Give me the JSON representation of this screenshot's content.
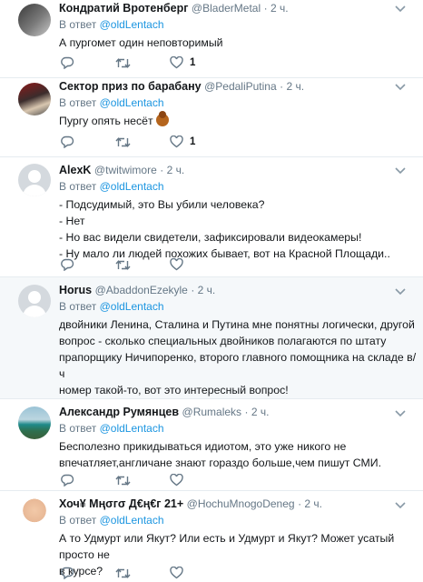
{
  "reply_prefix": "В ответ",
  "tweets": [
    {
      "name": "Кондратий Вротенберг",
      "handle": "@BladerMetal",
      "time": "· 2 ч.",
      "reply_to": "@oldLentach",
      "text": [
        "А пургомет один неповторимый"
      ],
      "likes": "1"
    },
    {
      "name": "Сектор приз по барабану",
      "handle": "@PedaliPutina",
      "time": "· 2 ч.",
      "reply_to": "@oldLentach",
      "text": [
        "Пургу опять несёт"
      ],
      "emoji": "person-facepalming",
      "likes": "1"
    },
    {
      "name": "AlexK",
      "handle": "@twitwimore",
      "time": "· 2 ч.",
      "reply_to": "@oldLentach",
      "text": [
        "- Подсудимый, это Вы убили человека?",
        "- Нет",
        "- Но вас видели свидетели, зафиксировали видеокамеры!",
        "- Ну мало ли людей похожих бывает, вот на Красной Площади.."
      ],
      "likes": ""
    },
    {
      "name": "Horus",
      "handle": "@AbaddonEzekyle",
      "time": "· 2 ч.",
      "reply_to": "@oldLentach",
      "text": [
        "двойники Ленина, Сталина и Путина мне понятны логически, другой",
        "вопрос - сколько специальных двойников полагаются по штату",
        "прапорщику Ничипоренко, второго главного помощника на складе в/ч",
        "номер такой-то, вот это интересный вопрос!"
      ],
      "likes": ""
    },
    {
      "name": "Александр Румянцев",
      "handle": "@Rumaleks",
      "time": "· 2 ч.",
      "reply_to": "@oldLentach",
      "text": [
        "Бесполезно прикидываться идиотом, это уже никого не",
        "впечатляет,англичане знают гораздо больше,чем пишут СМИ."
      ],
      "likes": ""
    },
    {
      "name": "Хоч¥ Мңσгσ Д€ң€г 21+",
      "handle": "@HochuMnogoDeneg",
      "time": "· 2 ч.",
      "reply_to": "@oldLentach",
      "text": [
        "А то Удмурт или Якут? Или есть и Удмурт и Якут? Может усатый просто не",
        "в курсе?"
      ],
      "likes": ""
    }
  ]
}
